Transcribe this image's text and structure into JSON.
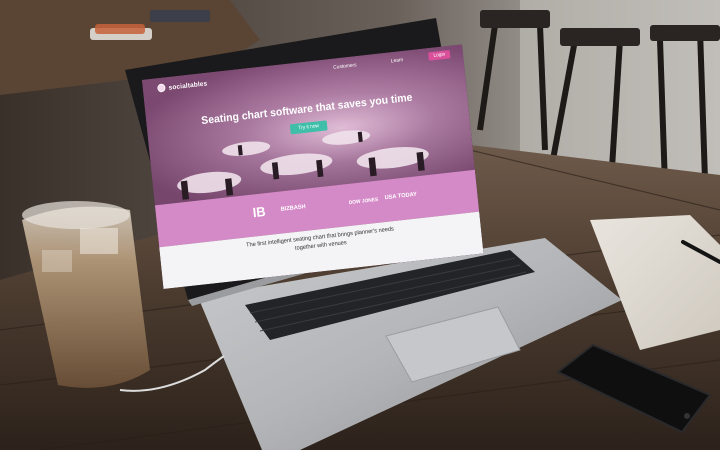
{
  "site": {
    "logo_text": "socialtables",
    "nav": [
      "Customers",
      "Learn"
    ],
    "login_label": "Login",
    "headline": "Seating chart software that saves you time",
    "cta_label": "Try it now",
    "press": [
      "IB",
      "BIZBASH",
      "DOW JONES",
      "USA TODAY"
    ],
    "tagline_line1": "The first intelligent seating chart that brings planner's needs",
    "tagline_line2": "together with venues"
  },
  "icons": [
    "logo-mark-icon",
    "nav-chevron-icon"
  ],
  "colors": {
    "accent_pink": "#d58ac8",
    "cta_teal": "#3fbfa9",
    "login_pink": "#d94f9a",
    "hero_purple": "#8f5b84"
  }
}
